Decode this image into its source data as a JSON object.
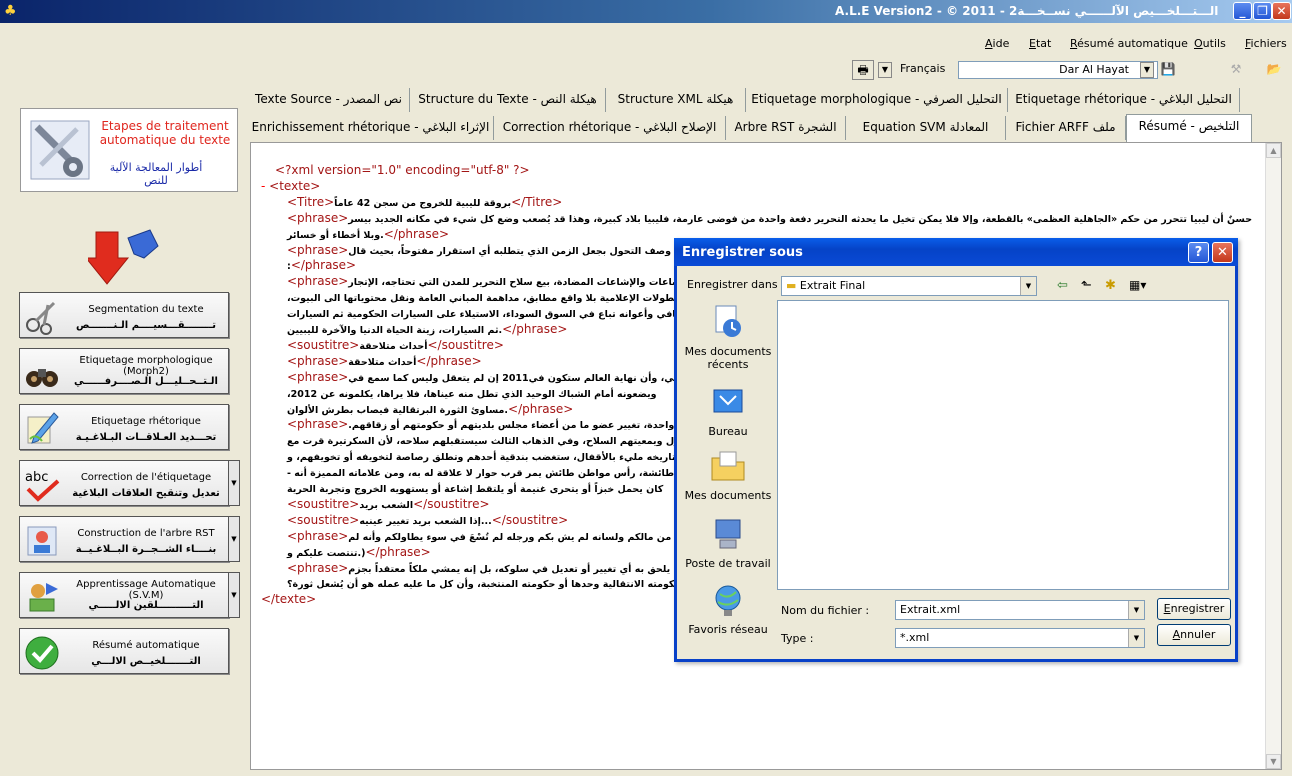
{
  "window": {
    "title": "A.L.E Version2  -  © 2011   -   الـــتـــلخـــيص الآلــــــي نســخـــة2"
  },
  "menu": [
    "Aide",
    "Etat",
    "Résumé automatique",
    "Outils",
    "Fichiers"
  ],
  "toolbar": {
    "language": "Français",
    "source": "Dar Al Hayat"
  },
  "left_panel": {
    "heading_fr": "Etapes de traitement automatique du texte",
    "heading_ar": "أطوار المعالجة الآلية للنص",
    "steps": [
      {
        "fr": "Segmentation du texte",
        "ar": "تــــــــقـــسيــــم الـنـــــــص"
      },
      {
        "fr": "Etiquetage morphologique (Morph2)",
        "ar": "الـتــحــليـــل الـصــــرفــــــي"
      },
      {
        "fr": "Etiquetage rhétorique",
        "ar": "تحـــديد العـلاقــات البـلاغـيـة"
      },
      {
        "fr": "Correction de l'étiquetage",
        "ar": "تعديل وتنقيح العلاقات البلاغية"
      },
      {
        "fr": "Construction de l'arbre RST",
        "ar": "بنــــاء الشــجــرة البــلاغـيــة"
      },
      {
        "fr": "Apprentissage Automatique (S.V.M)",
        "ar": "التــــــــــلقين الالـــــي"
      },
      {
        "fr": "Résumé automatique",
        "ar": "التـــــــلخيــص الالـــي"
      }
    ]
  },
  "tabs": {
    "row1": [
      "Texte Source - نص المصدر",
      "Structure du Texte - هيكلة النص",
      "Structure XML هيكلة",
      "Etiquetage morphologique - التحليل الصرفي",
      "Etiquetage rhétorique - التحليل البلاغي"
    ],
    "row2": [
      "Enrichissement rhétorique - الإثراء البلاغي",
      "Correction rhétorique - الإصلاح البلاغي",
      "Arbre RST الشجرة",
      "Equation SVM المعادلة",
      "Fichier ARFF ملف",
      "Résumé - التلخيص"
    ]
  },
  "editor": {
    "lines": [
      {
        "pre": "",
        "tag": "<?xml version=\"1.0\" encoding=\"utf-8\" ?>",
        "text": "",
        "close": ""
      },
      {
        "pre": "- ",
        "tag": "<texte>",
        "text": "",
        "close": ""
      },
      {
        "pre": "",
        "tag": "<Titre>",
        "text": "بروقة لليبية للخروج من سجن 42 عاماً",
        "close": "</Titre>"
      },
      {
        "pre": "",
        "tag": "<phrase>",
        "text": "حسنٌ أن ليبيا تتحرر من حكم «الجاهلية العظمى» بالقطعة، وإلا فلا يمكن تخيل ما يحدثه التحرير دفعة واحدة من فوضى عارمة، فليبيا بلاد كبيرة، وهذا قد يُصعب وضع كل شيء في مكانه الجديد بيسر",
        "close": ""
      },
      {
        "pre": "",
        "tag": "",
        "text": ".وبلا أخطاء أو خسائر",
        "close": "</phrase>"
      },
      {
        "pre": "",
        "tag": "<phrase>",
        "text": "ـاب وصف التحول بجعل الزمن الذي يتطلبه أي استقرار مفتوحاً، بحيث قال",
        "close": ""
      },
      {
        "pre": "",
        "tag": "",
        "text": ":",
        "close": "</phrase>"
      },
      {
        "pre": "",
        "tag": "<phrase>",
        "text": "لإشاعات والإشاعات المضادة، بيع سلاح التحرير للمدن التي تحتاجه، الإتجار",
        "close": ""
      },
      {
        "pre": "",
        "tag": "",
        "text": "البطولات الإعلامية بلا واقع مطابق، مداهمة المباني العامة ونقل محتوياتها الى البيوت،",
        "close": ""
      },
      {
        "pre": "",
        "tag": "",
        "text": "ثقافي وأعوانه تباع في السوق السوداء، الاستيلاء على السيارات الحكومية ثم السيارات",
        "close": ""
      },
      {
        "pre": "",
        "tag": "",
        "text": ".ثم السيارات، زينة الحياة الدنيا والآخرة لليبيين",
        "close": "</phrase>"
      },
      {
        "pre": "",
        "tag": "<soustitre>",
        "text": "أحداث متلاحقة",
        "close": "</soustitre>"
      },
      {
        "pre": "",
        "tag": "<phrase>",
        "text": "أحداث متلاحقة",
        "close": "</phrase>"
      },
      {
        "pre": "",
        "tag": "<phrase>",
        "text": "ثقافي، وأن نهاية العالم ستكون في2011 إن لم يتعقل وليس كما سمع في",
        "close": ""
      },
      {
        "pre": "",
        "tag": "",
        "text": "ويضعونه أمام الشباك الوحيد الذي تطل منه عيناها، فلا يراها، يكلمونه عن 2012،",
        "close": ""
      },
      {
        "pre": "",
        "tag": "",
        "text": ".مساوئ الثورة البرتقالية فيصاب بطرش الألوان",
        "close": "</phrase>"
      },
      {
        "pre": "",
        "tag": "<phrase>",
        "text": "ية واحدة، تغيير عضو ما من أعضاء مجلس بلديتهم أو حكومتهم أو زقاقهم.",
        "close": ""
      },
      {
        "pre": "",
        "tag": "",
        "text": "مسؤول ويمعيتهم السلاح، وفي الذهاب الثالث سيستقبلهم سلاحه، لأن السكرتيرة قرت مع",
        "close": ""
      },
      {
        "pre": "",
        "tag": "",
        "text": "وتاريخه مليء بالأقفال، ستغضب بندقية أحدهم وتطلق رصاصة لتخويفه أو تخويفهم، و",
        "close": ""
      },
      {
        "pre": "",
        "tag": "",
        "text": "طائشة، رأس مواطن طائش يمر قرب حوار لا علاقة له به، ومن علاماته المميزة أنه -",
        "close": ""
      },
      {
        "pre": "",
        "tag": "",
        "text": "كان يحمل خبزاً أو يتحرى غنيمة أو يلتقط إشاعة أو يستهويه الخروج وتجربة الحرية",
        "close": ""
      },
      {
        "pre": "",
        "tag": "<soustitre>",
        "text": "الشعب بريد",
        "close": "</soustitre>"
      },
      {
        "pre": "",
        "tag": "<soustitre>",
        "text": "...إذا الشعب بريد تغيير عينيه",
        "close": "</soustitre>"
      },
      {
        "pre": "",
        "tag": "<phrase>",
        "text": "ربهة من مالكم ولسانه لم يش بكم ورجله لم تُسْعَ في سوء يطاولكم وأنه لم",
        "close": ""
      },
      {
        "pre": "",
        "tag": "",
        "text": "(.تنتصت عليكم و",
        "close": "</phrase>"
      },
      {
        "pre": "",
        "tag": "<phrase>",
        "text": "أن يلحق به أي تغيير أو تعديل في سلوكه، بل إنه يمشي ملكاً معتقداً بجزم",
        "close": ""
      },
      {
        "pre": "",
        "tag": "",
        "text": "حكومته الانتقالية وحدها أو حكومته المنتخبة، وأن كل ما عليه عمله هو أن يُشعل ثورة؟",
        "close": ""
      },
      {
        "pre": "",
        "tag": "</texte>",
        "text": "",
        "close": ""
      }
    ]
  },
  "dialog": {
    "title": "Enregistrer sous",
    "save_in_label": "Enregistrer dans :",
    "save_in_value": "Extrait Final",
    "places": [
      "Mes documents récents",
      "Bureau",
      "Mes documents",
      "Poste de travail",
      "Favoris réseau"
    ],
    "filename_label": "Nom du fichier :",
    "filename_value": "Extrait.xml",
    "type_label": "Type :",
    "type_value": "*.xml",
    "save_button": "Enregistrer",
    "cancel_button": "Annuler"
  },
  "colors": {
    "xml_tag": "#a31515",
    "xml_bracket": "#0000ff",
    "dialog_title": "#0a4ad6",
    "heading_fr": "#e0261e",
    "heading_ar": "#1a2aa8"
  }
}
